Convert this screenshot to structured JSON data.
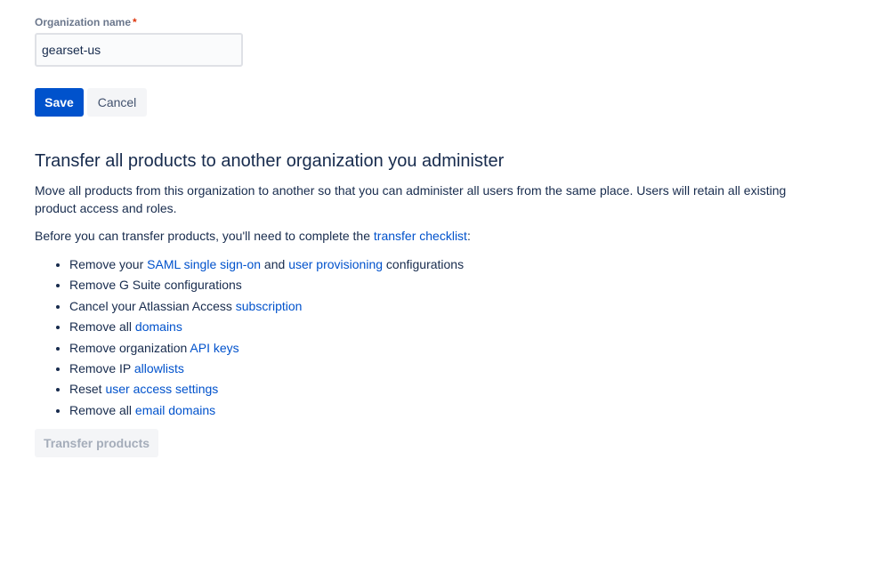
{
  "form": {
    "label": "Organization name",
    "required_mark": "*",
    "value": "gearset-us",
    "save_label": "Save",
    "cancel_label": "Cancel"
  },
  "transfer": {
    "title": "Transfer all products to another organization you administer",
    "description": "Move all products from this organization to another so that you can administer all users from the same place. Users will retain all existing product access and roles.",
    "intro_prefix": "Before you can transfer products, you'll need to complete the ",
    "intro_link": "transfer checklist",
    "intro_suffix": ":",
    "checklist": [
      {
        "pre": "Remove your ",
        "link": "SAML single sign-on",
        "mid": " and ",
        "link2": "user provisioning",
        "post": " configurations"
      },
      {
        "pre": "Remove G Suite configurations",
        "link": "",
        "post": ""
      },
      {
        "pre": "Cancel your Atlassian Access ",
        "link": "subscription",
        "post": ""
      },
      {
        "pre": "Remove all ",
        "link": "domains",
        "post": ""
      },
      {
        "pre": "Remove organization ",
        "link": "API keys",
        "post": ""
      },
      {
        "pre": "Remove IP ",
        "link": "allowlists",
        "post": ""
      },
      {
        "pre": "Reset ",
        "link": "user access settings",
        "post": ""
      },
      {
        "pre": "Remove all ",
        "link": "email domains",
        "post": ""
      }
    ],
    "button_label": "Transfer products"
  }
}
